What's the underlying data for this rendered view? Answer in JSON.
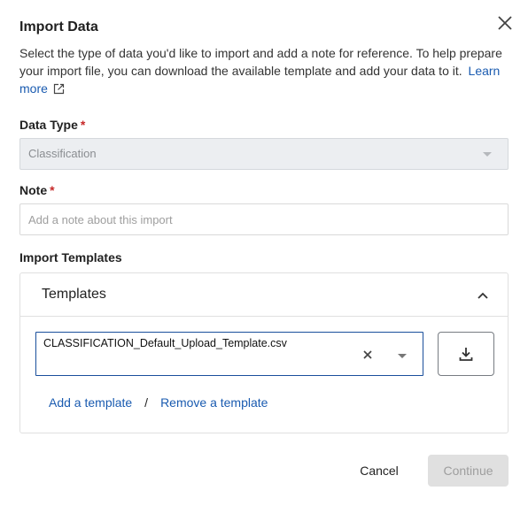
{
  "dialog": {
    "title": "Import Data",
    "description": "Select the type of data you'd like to import and add a note for reference. To help prepare your import file, you can download the available template and add your data to it.",
    "learn_more": "Learn more",
    "close_icon": "close-icon"
  },
  "data_type": {
    "label": "Data Type",
    "required_marker": "*",
    "value": "Classification",
    "disabled": true
  },
  "note": {
    "label": "Note",
    "required_marker": "*",
    "value": "",
    "placeholder": "Add a note about this import"
  },
  "import_templates": {
    "label": "Import Templates",
    "panel_title": "Templates",
    "expanded": true,
    "selected_template": "CLASSIFICATION_Default_Upload_Template.csv",
    "add_link": "Add a template",
    "separator": "/",
    "remove_link": "Remove a template"
  },
  "footer": {
    "cancel_label": "Cancel",
    "continue_label": "Continue",
    "continue_disabled": true
  },
  "colors": {
    "link": "#1a5bb0",
    "required": "#c62828",
    "focus_border": "#1a4f9c",
    "disabled_bg": "#e0e0e0"
  }
}
